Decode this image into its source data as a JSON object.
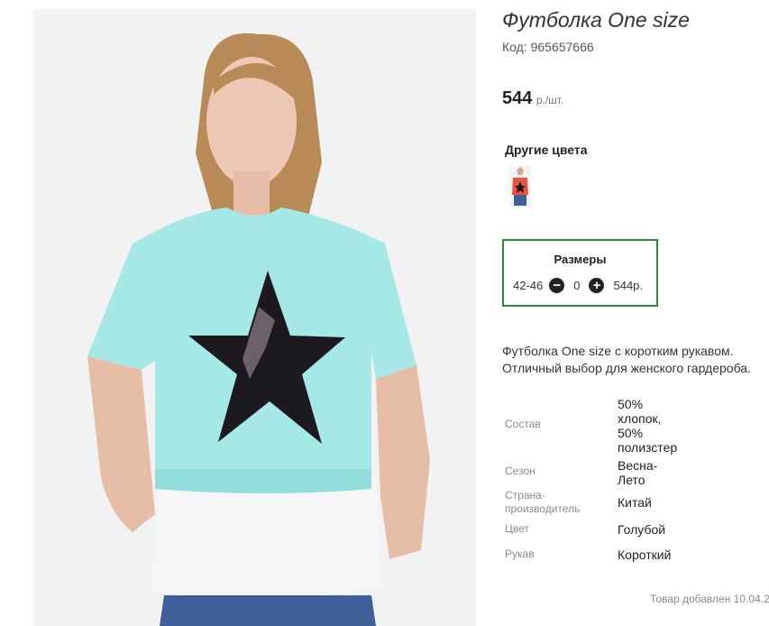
{
  "product": {
    "title": "Футболка One size",
    "code_label": "Код:",
    "code_value": "965657666",
    "price_value": "544",
    "price_unit": "р./шт."
  },
  "other_colors": {
    "title": "Другие цвета",
    "swatch_color": "#e8553f"
  },
  "sizes": {
    "title": "Размеры",
    "size": "42-46",
    "quantity": "0",
    "price": "544р."
  },
  "description": {
    "line1": "Футболка One size с коротким рукавом.",
    "line2": "Отличный выбор для женского гардероба."
  },
  "properties": [
    {
      "label": "Состав",
      "value": "50% хлопок, 50% полизстер"
    },
    {
      "label": "Сезон",
      "value": "Весна-Лето"
    },
    {
      "label": "Страна-производитель",
      "value": "Китай"
    },
    {
      "label": "Цвет",
      "value": "Голубой"
    },
    {
      "label": "Рукав",
      "value": "Короткий"
    }
  ],
  "footer": {
    "added_text": "Товар добавлен 10.04.2"
  },
  "colors": {
    "accent_border": "#2e8b2e",
    "shirt": "#a6e8e6",
    "star": "#1d1a1f",
    "undershirt": "#f4f4f6"
  }
}
